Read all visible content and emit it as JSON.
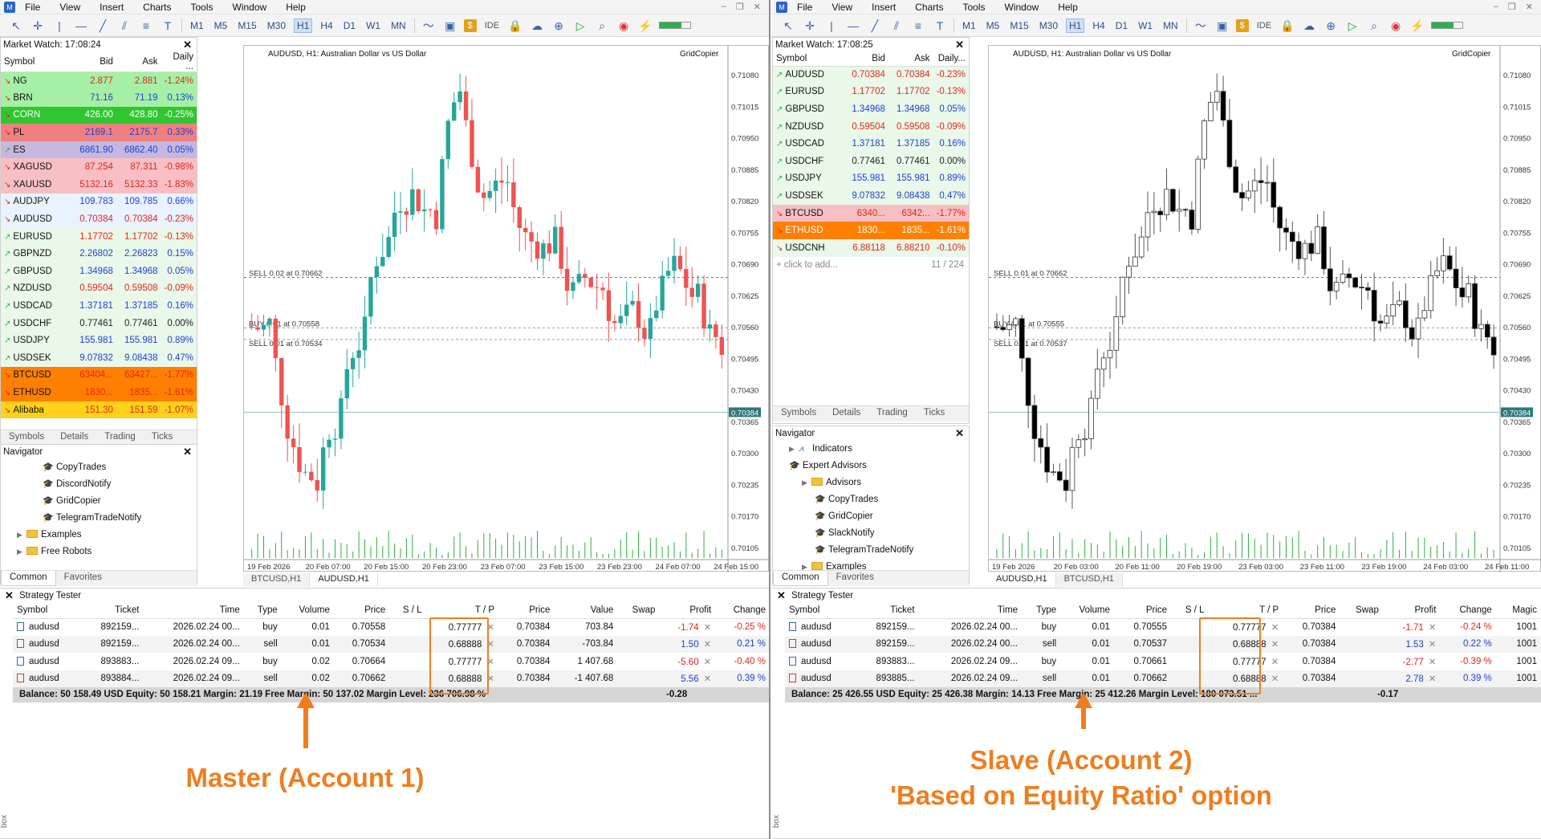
{
  "menu": [
    "File",
    "View",
    "Insert",
    "Charts",
    "Tools",
    "Window",
    "Help"
  ],
  "timeframes": [
    "M1",
    "M5",
    "M15",
    "M30",
    "H1",
    "H4",
    "D1",
    "W1",
    "MN"
  ],
  "toolbar_ide": "IDE",
  "win1": {
    "market_watch": {
      "title": "Market Watch: 17:08:24",
      "cols": [
        "Symbol",
        "Bid",
        "Ask",
        "Daily ..."
      ],
      "rows": [
        {
          "sym": "NG",
          "bid": "2.877",
          "ask": "2.881",
          "daily": "-1.24%",
          "bg": "#a6f0a6",
          "dir": "dn",
          "fg": "#e2261c"
        },
        {
          "sym": "BRN",
          "bid": "71.16",
          "ask": "71.19",
          "daily": "0.13%",
          "bg": "#a6f0a6",
          "dir": "dn",
          "fg": "#1e3fd8"
        },
        {
          "sym": "CORN",
          "bid": "426.00",
          "ask": "428.80",
          "daily": "-0.25%",
          "bg": "#30c630",
          "dir": "dn",
          "fg": "#e2261c",
          "sel": true
        },
        {
          "sym": "PL",
          "bid": "2169.1",
          "ask": "2175.7",
          "daily": "0.33%",
          "bg": "#f08080",
          "dir": "dn",
          "fg": "#1e3fd8"
        },
        {
          "sym": "ES",
          "bid": "6861.90",
          "ask": "6862.40",
          "daily": "0.05%",
          "bg": "#c4b8e0",
          "dir": "up",
          "fg": "#1e3fd8"
        },
        {
          "sym": "XAGUSD",
          "bid": "87.254",
          "ask": "87.311",
          "daily": "-0.98%",
          "bg": "#f7bfc4",
          "dir": "dn",
          "fg": "#e2261c"
        },
        {
          "sym": "XAUUSD",
          "bid": "5132.16",
          "ask": "5132.33",
          "daily": "-1.83%",
          "bg": "#f7bfc4",
          "dir": "dn",
          "fg": "#e2261c"
        },
        {
          "sym": "AUDJPY",
          "bid": "109.783",
          "ask": "109.785",
          "daily": "0.66%",
          "bg": "#e8f3ff",
          "dir": "dn",
          "fg": "#1e3fd8"
        },
        {
          "sym": "AUDUSD",
          "bid": "0.70384",
          "ask": "0.70384",
          "daily": "-0.23%",
          "bg": "#e8f3ff",
          "dir": "dn",
          "fg": "#e2261c"
        },
        {
          "sym": "EURUSD",
          "bid": "1.17702",
          "ask": "1.17702",
          "daily": "-0.13%",
          "bg": "#e9f8e9",
          "dir": "up",
          "fg": "#e2261c"
        },
        {
          "sym": "GBPNZD",
          "bid": "2.26802",
          "ask": "2.26823",
          "daily": "0.15%",
          "bg": "#e9f8e9",
          "dir": "up",
          "fg": "#1e3fd8"
        },
        {
          "sym": "GBPUSD",
          "bid": "1.34968",
          "ask": "1.34968",
          "daily": "0.05%",
          "bg": "#e9f8e9",
          "dir": "up",
          "fg": "#1e3fd8"
        },
        {
          "sym": "NZDUSD",
          "bid": "0.59504",
          "ask": "0.59508",
          "daily": "-0.09%",
          "bg": "#e9f8e9",
          "dir": "up",
          "fg": "#e2261c"
        },
        {
          "sym": "USDCAD",
          "bid": "1.37181",
          "ask": "1.37185",
          "daily": "0.16%",
          "bg": "#e9f8e9",
          "dir": "up",
          "fg": "#1e3fd8"
        },
        {
          "sym": "USDCHF",
          "bid": "0.77461",
          "ask": "0.77461",
          "daily": "0.00%",
          "bg": "#e9f8e9",
          "dir": "up",
          "fg": "#222"
        },
        {
          "sym": "USDJPY",
          "bid": "155.981",
          "ask": "155.981",
          "daily": "0.89%",
          "bg": "#e9f8e9",
          "dir": "up",
          "fg": "#1e3fd8"
        },
        {
          "sym": "USDSEK",
          "bid": "9.07832",
          "ask": "9.08438",
          "daily": "0.47%",
          "bg": "#e9f8e9",
          "dir": "up",
          "fg": "#1e3fd8"
        },
        {
          "sym": "BTCUSD",
          "bid": "63404...",
          "ask": "63427...",
          "daily": "-1.77%",
          "bg": "#ff7f00",
          "dir": "dn",
          "fg": "#e2261c"
        },
        {
          "sym": "ETHUSD",
          "bid": "1830...",
          "ask": "1835...",
          "daily": "-1.61%",
          "bg": "#ff7f00",
          "dir": "dn",
          "fg": "#e2261c"
        },
        {
          "sym": "Alibaba",
          "bid": "151.30",
          "ask": "151.59",
          "daily": "-1.07%",
          "bg": "#ffd11a",
          "dir": "dn",
          "fg": "#e2261c"
        }
      ]
    },
    "mw_tabs": [
      "Symbols",
      "Details",
      "Trading",
      "Ticks"
    ],
    "navigator": {
      "title": "Navigator",
      "items": [
        {
          "t": "CopyTrades",
          "type": "ea",
          "ind": 3
        },
        {
          "t": "DiscordNotify",
          "type": "ea",
          "ind": 3
        },
        {
          "t": "GridCopier",
          "type": "ea",
          "ind": 3
        },
        {
          "t": "TelegramTradeNotify",
          "type": "ea",
          "ind": 3
        },
        {
          "t": "Examples",
          "type": "folder",
          "ind": 1
        },
        {
          "t": "Free Robots",
          "type": "folder",
          "ind": 1
        }
      ]
    },
    "nav_tabs": [
      "Common",
      "Favorites"
    ],
    "chart": {
      "title": "AUDUSD, H1:  Australian Dollar vs US Dollar",
      "ea": "GridCopier",
      "price_labels": [
        "0.71080",
        "0.71015",
        "0.70950",
        "0.70885",
        "0.70820",
        "0.70755",
        "0.70690",
        "0.70625",
        "0.70560",
        "0.70495",
        "0.70430",
        "0.70384",
        "0.70365",
        "0.70300",
        "0.70235",
        "0.70170",
        "0.70105"
      ],
      "time_labels": [
        "19 Feb 2026",
        "20 Feb 07:00",
        "20 Feb 15:00",
        "20 Feb 23:00",
        "23 Feb 07:00",
        "23 Feb 15:00",
        "23 Feb 23:00",
        "24 Feb 07:00",
        "24 Feb 15:00"
      ],
      "order_labels": [
        "SELL 0.02 at 0.70662",
        "BUY 0.01 at 0.70558",
        "SELL 0.01 at 0.70534"
      ],
      "tabs": [
        "BTCUSD,H1",
        "AUDUSD,H1"
      ]
    },
    "tester": {
      "title": "Strategy Tester",
      "cols": [
        "Symbol",
        "Ticket",
        "Time",
        "Type",
        "Volume",
        "Price",
        "S / L",
        "T / P",
        "Price",
        "Value",
        "Swap",
        "Profit",
        "Change"
      ],
      "rows": [
        {
          "sym": "audusd",
          "ticket": "892159...",
          "time": "2026.02.24 00...",
          "type": "buy",
          "vol": "0.01",
          "price": "0.70558",
          "sl": "",
          "tp": "0.77777",
          "cur": "0.70384",
          "value": "703.84",
          "swap": "",
          "profit": "-1.74",
          "change": "-0.25 %",
          "neg": true
        },
        {
          "sym": "audusd",
          "ticket": "892159...",
          "time": "2026.02.24 00...",
          "type": "sell",
          "vol": "0.01",
          "price": "0.70534",
          "sl": "",
          "tp": "0.68888",
          "cur": "0.70384",
          "value": "-703.84",
          "swap": "",
          "profit": "1.50",
          "change": "0.21 %",
          "neg": false
        },
        {
          "sym": "audusd",
          "ticket": "893883...",
          "time": "2026.02.24 09...",
          "type": "buy",
          "vol": "0.02",
          "price": "0.70664",
          "sl": "",
          "tp": "0.77777",
          "cur": "0.70384",
          "value": "1 407.68",
          "swap": "",
          "profit": "-5.60",
          "change": "-0.40 %",
          "neg": true
        },
        {
          "sym": "audusd",
          "ticket": "893884...",
          "time": "2026.02.24 09...",
          "type": "sell",
          "vol": "0.02",
          "price": "0.70662",
          "sl": "",
          "tp": "0.68888",
          "cur": "0.70384",
          "value": "-1 407.68",
          "swap": "",
          "profit": "5.56",
          "change": "0.39 %",
          "neg": false
        }
      ],
      "balance": "Balance: 50 158.49 USD  Equity: 50 158.21  Margin: 21.19  Free Margin: 50 137.02  Margin Level: 236 706.98 %",
      "total": "-0.28"
    },
    "callout": "Master (Account 1)"
  },
  "win2": {
    "market_watch": {
      "title": "Market Watch: 17:08:25",
      "cols": [
        "Symbol",
        "Bid",
        "Ask",
        "Daily..."
      ],
      "rows": [
        {
          "sym": "AUDUSD",
          "bid": "0.70384",
          "ask": "0.70384",
          "daily": "-0.23%",
          "bg": "#e9f8e9",
          "dir": "up",
          "fg": "#e2261c"
        },
        {
          "sym": "EURUSD",
          "bid": "1.17702",
          "ask": "1.17702",
          "daily": "-0.13%",
          "bg": "#e9f8e9",
          "dir": "up",
          "fg": "#e2261c"
        },
        {
          "sym": "GBPUSD",
          "bid": "1.34968",
          "ask": "1.34968",
          "daily": "0.05%",
          "bg": "#e9f8e9",
          "dir": "up",
          "fg": "#1e3fd8"
        },
        {
          "sym": "NZDUSD",
          "bid": "0.59504",
          "ask": "0.59508",
          "daily": "-0.09%",
          "bg": "#e9f8e9",
          "dir": "up",
          "fg": "#e2261c"
        },
        {
          "sym": "USDCAD",
          "bid": "1.37181",
          "ask": "1.37185",
          "daily": "0.16%",
          "bg": "#e9f8e9",
          "dir": "up",
          "fg": "#1e3fd8"
        },
        {
          "sym": "USDCHF",
          "bid": "0.77461",
          "ask": "0.77461",
          "daily": "0.00%",
          "bg": "#e9f8e9",
          "dir": "up",
          "fg": "#222"
        },
        {
          "sym": "USDJPY",
          "bid": "155.981",
          "ask": "155.981",
          "daily": "0.89%",
          "bg": "#e9f8e9",
          "dir": "up",
          "fg": "#1e3fd8"
        },
        {
          "sym": "USDSEK",
          "bid": "9.07832",
          "ask": "9.08438",
          "daily": "0.47%",
          "bg": "#e9f8e9",
          "dir": "up",
          "fg": "#1e3fd8"
        },
        {
          "sym": "BTCUSD",
          "bid": "6340...",
          "ask": "6342...",
          "daily": "-1.77%",
          "bg": "#f7bfc4",
          "dir": "dn",
          "fg": "#e2261c"
        },
        {
          "sym": "ETHUSD",
          "bid": "1830...",
          "ask": "1835...",
          "daily": "-1.61%",
          "bg": "#ff7f00",
          "dir": "dn",
          "fg": "#e2261c",
          "sel": true
        },
        {
          "sym": "USDCNH",
          "bid": "6.88118",
          "ask": "6.88210",
          "daily": "-0.10%",
          "bg": "#e9f8e9",
          "dir": "dn",
          "fg": "#e2261c"
        }
      ],
      "add": "click to add...",
      "count": "11 / 224"
    },
    "mw_tabs": [
      "Symbols",
      "Details",
      "Trading",
      "Ticks"
    ],
    "navigator": {
      "title": "Navigator",
      "items": [
        {
          "t": "Indicators",
          "type": "ind",
          "ind": 1
        },
        {
          "t": "Expert Advisors",
          "type": "ea",
          "ind": 1
        },
        {
          "t": "Advisors",
          "type": "folder",
          "ind": 2
        },
        {
          "t": "CopyTrades",
          "type": "ea",
          "ind": 3
        },
        {
          "t": "GridCopier",
          "type": "ea",
          "ind": 3
        },
        {
          "t": "SlackNotify",
          "type": "ea",
          "ind": 3
        },
        {
          "t": "TelegramTradeNotify",
          "type": "ea",
          "ind": 3
        },
        {
          "t": "Examples",
          "type": "folder",
          "ind": 2
        }
      ]
    },
    "nav_tabs": [
      "Common",
      "Favorites"
    ],
    "chart": {
      "title": "AUDUSD, H1:  Australian Dollar vs US Dollar",
      "ea": "GridCopier",
      "price_labels": [
        "0.71080",
        "0.71015",
        "0.70950",
        "0.70885",
        "0.70820",
        "0.70755",
        "0.70690",
        "0.70625",
        "0.70560",
        "0.70495",
        "0.70430",
        "0.70384",
        "0.70365",
        "0.70300",
        "0.70235",
        "0.70170",
        "0.70105"
      ],
      "time_labels": [
        "19 Feb 2026",
        "20 Feb 03:00",
        "20 Feb 11:00",
        "20 Feb 19:00",
        "23 Feb 03:00",
        "23 Feb 11:00",
        "23 Feb 19:00",
        "24 Feb 03:00",
        "24 Feb 11:00"
      ],
      "order_labels": [
        "SELL 0.01 at 0.70662",
        "BUY 0.01 at 0.70555",
        "SELL 0.01 at 0.70537"
      ],
      "tabs": [
        "AUDUSD,H1",
        "BTCUSD,H1"
      ]
    },
    "tester": {
      "title": "Strategy Tester",
      "cols": [
        "Symbol",
        "Ticket",
        "Time",
        "Type",
        "Volume",
        "Price",
        "S / L",
        "T / P",
        "Price",
        "Swap",
        "Profit",
        "Change",
        "Magic"
      ],
      "rows": [
        {
          "sym": "audusd",
          "ticket": "892159...",
          "time": "2026.02.24 00...",
          "type": "buy",
          "vol": "0.01",
          "price": "0.70555",
          "sl": "",
          "tp": "0.77777",
          "cur": "0.70384",
          "swap": "",
          "profit": "-1.71",
          "change": "-0.24 %",
          "magic": "1001",
          "neg": true
        },
        {
          "sym": "audusd",
          "ticket": "892159...",
          "time": "2026.02.24 00...",
          "type": "sell",
          "vol": "0.01",
          "price": "0.70537",
          "sl": "",
          "tp": "0.68888",
          "cur": "0.70384",
          "swap": "",
          "profit": "1.53",
          "change": "0.22 %",
          "magic": "1001",
          "neg": false
        },
        {
          "sym": "audusd",
          "ticket": "893883...",
          "time": "2026.02.24 09...",
          "type": "buy",
          "vol": "0.01",
          "price": "0.70661",
          "sl": "",
          "tp": "0.77777",
          "cur": "0.70384",
          "swap": "",
          "profit": "-2.77",
          "change": "-0.39 %",
          "magic": "1001",
          "neg": true
        },
        {
          "sym": "audusd",
          "ticket": "893885...",
          "time": "2026.02.24 09...",
          "type": "sell",
          "vol": "0.01",
          "price": "0.70662",
          "sl": "",
          "tp": "0.68888",
          "cur": "0.70384",
          "swap": "",
          "profit": "2.78",
          "change": "0.39 %",
          "magic": "1001",
          "neg": false
        }
      ],
      "balance": "Balance: 25 426.55 USD  Equity: 25 426.38  Margin: 14.13  Free Margin: 25 412.26  Margin Level: 180 073.51 ...",
      "total": "-0.17"
    },
    "callout1": "Slave (Account 2)",
    "callout2": "'Based on Equity Ratio' option"
  },
  "colors": {
    "bull_color": "#26a69a",
    "bear_color": "#ef5350",
    "accent": "#ef7d1e"
  }
}
